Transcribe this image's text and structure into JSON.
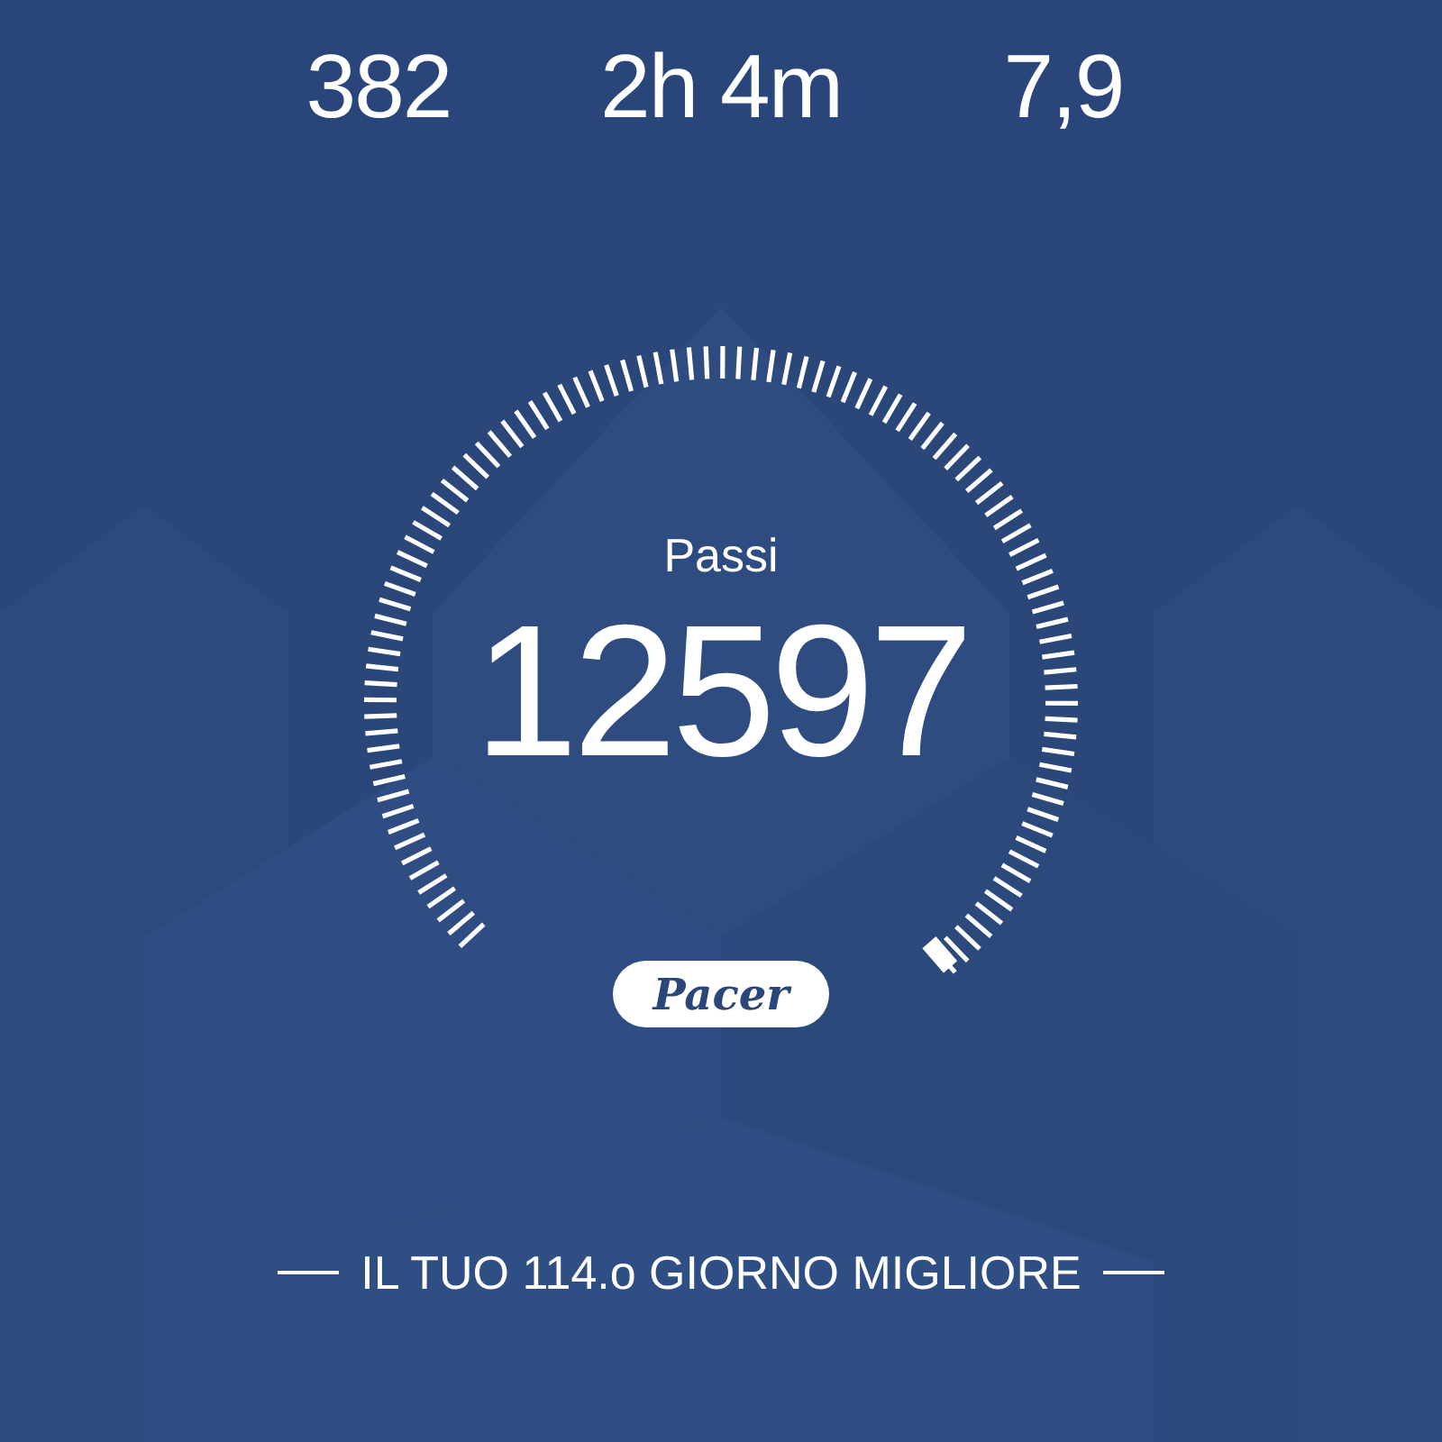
{
  "stats": [
    {
      "value": "382"
    },
    {
      "value": "2h 4m"
    },
    {
      "value": "7,9"
    }
  ],
  "gauge": {
    "label": "Passi",
    "value": "12597"
  },
  "badge": {
    "text": "Pacer"
  },
  "footer": {
    "text": "IL TUO 114.o GIORNO MIGLIORE"
  }
}
